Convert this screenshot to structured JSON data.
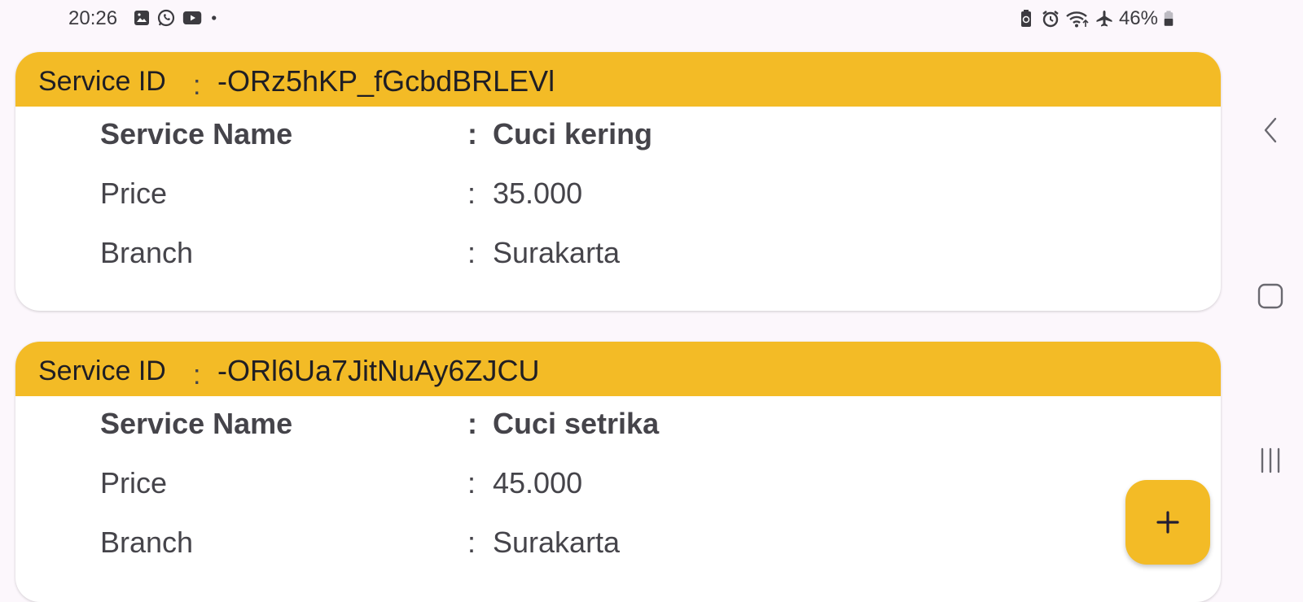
{
  "status_bar": {
    "time": "20:26",
    "left_icons": [
      "image-icon",
      "whatsapp-icon",
      "youtube-icon",
      "dot-icon"
    ],
    "right_icons": [
      "battery-saver-icon",
      "alarm-icon",
      "wifi-icon",
      "airplane-mode-icon"
    ],
    "battery_percent": "46%"
  },
  "cards": [
    {
      "header_label": "Service ID",
      "header_colon": ":",
      "service_id": "-ORz5hKP_fGcbdBRLEVl",
      "rows": [
        {
          "label": "Service Name",
          "value": "Cuci kering"
        },
        {
          "label": "Price",
          "value": "35.000"
        },
        {
          "label": "Branch",
          "value": "Surakarta"
        }
      ]
    },
    {
      "header_label": "Service ID",
      "header_colon": ":",
      "service_id": "-ORl6Ua7JitNuAy6ZJCU",
      "rows": [
        {
          "label": "Service Name",
          "value": "Cuci setrika"
        },
        {
          "label": "Price",
          "value": "45.000"
        },
        {
          "label": "Branch",
          "value": "Surakarta"
        }
      ]
    }
  ],
  "colon": ":",
  "fab_icon": "plus-icon",
  "colors": {
    "accent": "#f3bb26",
    "background": "#fcf7fc",
    "text": "#45444a"
  },
  "nav_bar": [
    "back-icon",
    "home-icon",
    "recents-icon"
  ]
}
